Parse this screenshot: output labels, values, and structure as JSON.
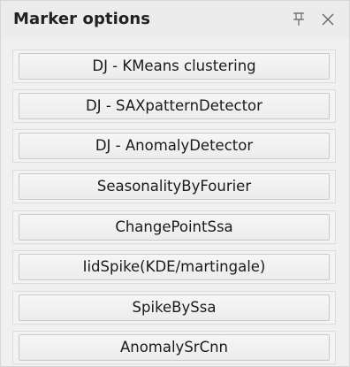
{
  "panel": {
    "title": "Marker options",
    "pin_icon": "pin-icon",
    "close_icon": "close-icon"
  },
  "buttons": [
    {
      "label": "DJ - KMeans clustering"
    },
    {
      "label": "DJ - SAXpatternDetector"
    },
    {
      "label": "DJ - AnomalyDetector"
    },
    {
      "label": "SeasonalityByFourier"
    },
    {
      "label": "ChangePointSsa"
    },
    {
      "label": "IidSpike(KDE/martingale)"
    },
    {
      "label": "SpikeBySsa"
    },
    {
      "label": "AnomalySrCnn"
    }
  ]
}
